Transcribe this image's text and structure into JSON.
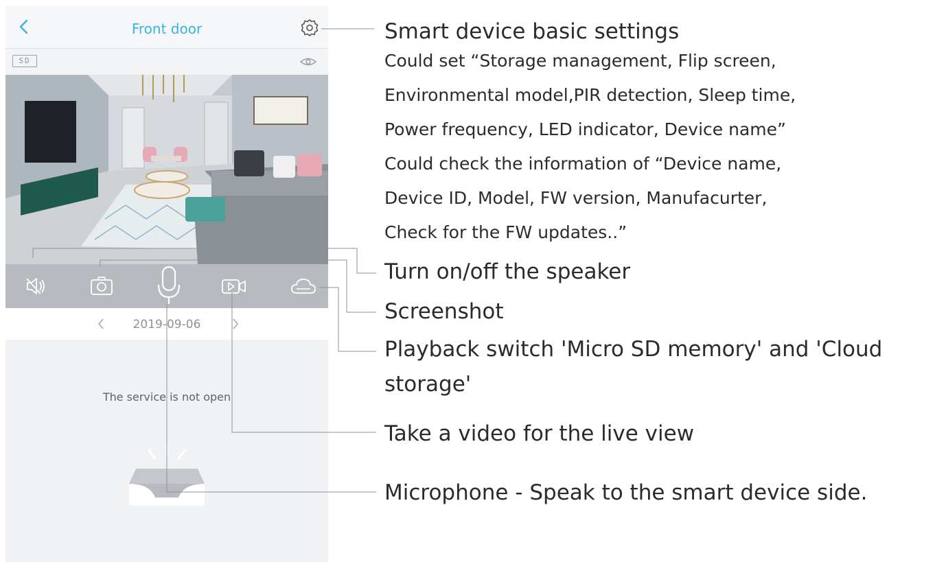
{
  "app": {
    "title": "Front door",
    "sd_badge": "SD",
    "date": "2019-09-06",
    "service_message": "The service is not open",
    "icons": {
      "back": "chevron-left-icon",
      "settings": "gear-icon",
      "visibility": "eye-icon",
      "speaker": "speaker-mute-icon",
      "screenshot": "camera-icon",
      "microphone": "microphone-icon",
      "record": "video-record-icon",
      "playback": "cloud-icon",
      "date_prev": "chevron-left-icon",
      "date_next": "chevron-right-icon",
      "empty": "empty-box-icon"
    },
    "colors": {
      "accent": "#35b5df",
      "control_bar": "#b7bbc0",
      "background": "#f1f2f4"
    }
  },
  "annotations": {
    "settings_title": "Smart device basic settings",
    "settings_lines": [
      "Could set  “Storage management, Flip screen,",
      "Environmental model,PIR detection, Sleep time,",
      "Power frequency, LED indicator, Device name”",
      "Could check the information of  “Device name,",
      "Device ID, Model, FW version, Manufacurter,",
      "Check for the FW updates..”"
    ],
    "speaker": "Turn on/off the speaker",
    "screenshot": "Screenshot",
    "playback_line1": "Playback  switch 'Micro SD memory' and 'Cloud",
    "playback_line2": "storage'",
    "video": "Take a video for the live view",
    "microphone": "Microphone - Speak to the smart device side."
  }
}
